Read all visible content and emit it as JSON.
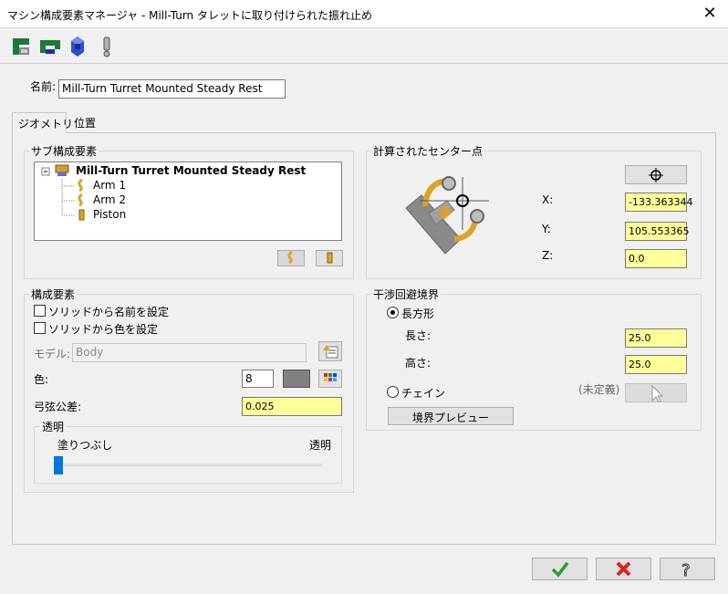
{
  "window": {
    "title": "マシン構成要素マネージャ - Mill-Turn タレットに取り付けられた振れ止め",
    "close": "✕"
  },
  "toolbar": {
    "icons": [
      "component-new-icon",
      "component-attach-icon",
      "component-part-icon",
      "warning-icon"
    ]
  },
  "name": {
    "label": "名前:",
    "value": "Mill-Turn Turret Mounted Steady Rest"
  },
  "tabs": [
    {
      "label": "ジオメトリ",
      "active": true
    },
    {
      "label": "位置",
      "active": false
    }
  ],
  "sub_components": {
    "title": "サブ構成要素",
    "root": "Mill-Turn Turret Mounted Steady Rest",
    "items": [
      "Arm 1",
      "Arm 2",
      "Piston"
    ]
  },
  "center": {
    "title": "計算されたセンター点",
    "x_label": "X:",
    "x_value": "-133.363344",
    "y_label": "Y:",
    "y_value": "105.553365",
    "z_label": "Z:",
    "z_value": "0.0"
  },
  "component": {
    "title": "構成要素",
    "name_from_solid": "ソリッドから名前を設定",
    "color_from_solid": "ソリッドから色を設定",
    "model_label": "モデル:",
    "model_value": "Body",
    "color_label": "色:",
    "color_value": "8",
    "chord_label": "弓弦公差:",
    "chord_value": "0.025",
    "transparency_title": "透明",
    "transparency_min": "塗りつぶし",
    "transparency_max": "透明",
    "transparency_level": 0
  },
  "clearance": {
    "title": "干渉回避境界",
    "rect_label": "長方形",
    "length_label": "長さ:",
    "length_value": "25.0",
    "height_label": "高さ:",
    "height_value": "25.0",
    "chain_label": "チェイン",
    "undefined_label": "(未定義)",
    "preview_button": "境界プレビュー"
  },
  "colors": {
    "input_yellow": "#ffff99",
    "swatch_gray": "#808080",
    "ok_green": "#2e9e2e",
    "cancel_red": "#e02020",
    "arm_gold": "#d9a32a"
  }
}
